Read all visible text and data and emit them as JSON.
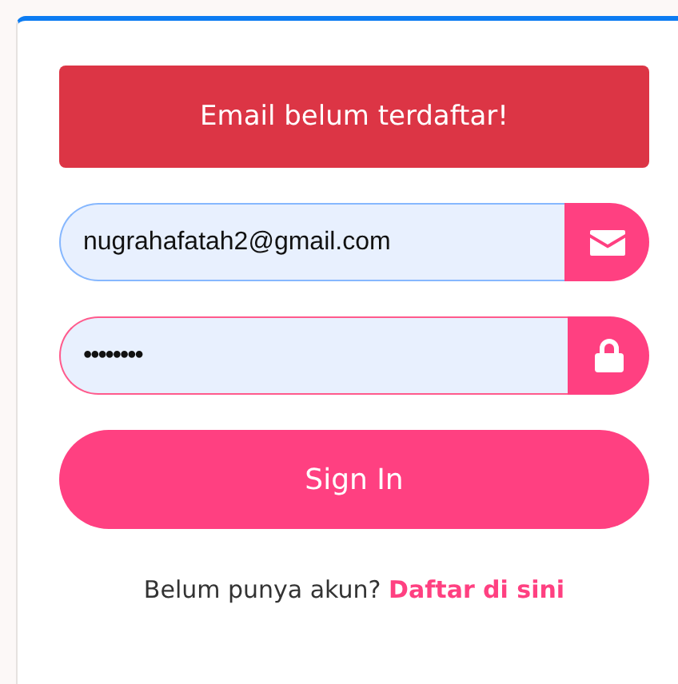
{
  "alert": {
    "message": "Email belum terdaftar!"
  },
  "fields": [
    {
      "kind": "email",
      "value": "nugrahafatah2@gmail.com"
    },
    {
      "kind": "password",
      "value": "••••••••"
    }
  ],
  "submit_button": {
    "label": "Sign In"
  },
  "signup": {
    "text": "Belum punya akun?",
    "link": "Daftar di sini"
  }
}
